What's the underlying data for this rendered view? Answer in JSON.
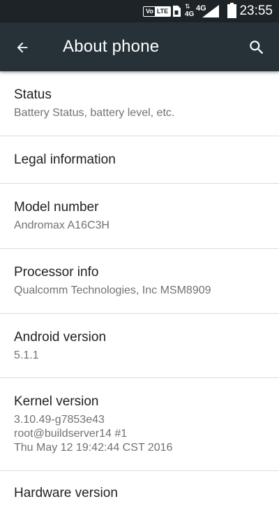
{
  "status_bar": {
    "volte_vo": "Vo",
    "volte_lte": "LTE",
    "net_small": "4G",
    "net_big": "4G",
    "net_arrows": "⇅",
    "time": "23:55",
    "icons": [
      "volte-icon",
      "sim-icon",
      "4g-icon",
      "signal-icon",
      "battery-icon"
    ]
  },
  "app_bar": {
    "title": "About phone",
    "back_icon": "arrow-back-icon",
    "search_icon": "search-icon"
  },
  "settings": {
    "items": [
      {
        "title": "Status",
        "lines": [
          "Battery Status, battery level, etc."
        ]
      },
      {
        "title": "Legal information",
        "lines": []
      },
      {
        "title": "Model number",
        "lines": [
          "Andromax A16C3H"
        ]
      },
      {
        "title": "Processor info",
        "lines": [
          "Qualcomm Technologies, Inc MSM8909"
        ]
      },
      {
        "title": "Android version",
        "lines": [
          "5.1.1"
        ]
      },
      {
        "title": "Kernel version",
        "lines": [
          "3.10.49-g7853e43",
          "root@buildserver14 #1",
          "Thu May 12 19:42:44 CST 2016"
        ]
      },
      {
        "title": "Hardware version",
        "lines": []
      }
    ]
  },
  "colors": {
    "status_bar_bg": "#1d2326",
    "app_bar_bg": "#263238",
    "title_text": "#212121",
    "secondary_text": "#727272",
    "divider": "#dcdcdc"
  }
}
